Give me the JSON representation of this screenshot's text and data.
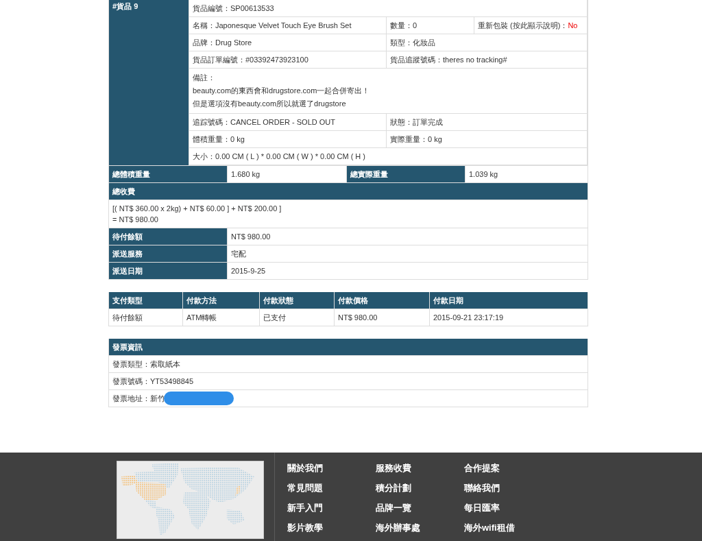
{
  "product": {
    "label": "#貨品 9",
    "rows": [
      [
        {
          "text": "貨品編號：SP00613533"
        }
      ],
      [
        {
          "text": "名稱：Japonesque Velvet Touch Eye Brush Set"
        },
        {
          "text": "數量：0"
        },
        {
          "text": "重新包裝 (按此顯示說明)：",
          "value": "No",
          "kind": "alert"
        }
      ],
      [
        {
          "text": "品牌：Drug Store"
        },
        {
          "text": "類型：化妝品"
        }
      ],
      [
        {
          "text": "貨品訂單編號：#03392473923100"
        },
        {
          "text": "貨品追蹤號碼：theres no tracking#"
        }
      ],
      [
        {
          "text": "備註：",
          "lines": [
            "beauty.com的東西會和drugstore.com一起合併寄出！",
            "但是選項沒有beauty.com所以就選了drugstore"
          ],
          "kind": "note"
        }
      ],
      [
        {
          "text": "追踪號碼：CANCEL ORDER - SOLD OUT"
        },
        {
          "text": "狀態：訂單完成"
        }
      ],
      [
        {
          "text": "體積重量：0 kg"
        },
        {
          "text": "實際重量：0 kg"
        }
      ],
      [
        {
          "text": "大小：0.00 CM ( L ) * 0.00 CM ( W ) * 0.00 CM ( H )"
        }
      ]
    ]
  },
  "weights": [
    {
      "label": "總體積重量",
      "value": "1.680 kg"
    },
    {
      "label": "總實際重量",
      "value": "1.039 kg"
    }
  ],
  "total_fee": {
    "label": "總收費",
    "lines": [
      "[( NT$ 360.00 x 2kg) + NT$ 60.00 ] + NT$ 200.00 ]",
      "= NT$ 980.00"
    ]
  },
  "summary": [
    {
      "label": "待付餘額",
      "value": "NT$ 980.00"
    },
    {
      "label": "派送服務",
      "value": "宅配"
    },
    {
      "label": "派送日期",
      "value": "2015-9-25"
    }
  ],
  "payments": {
    "columns": [
      "支付類型",
      "付款方法",
      "付款狀態",
      "付款價格",
      "付款日期"
    ],
    "rows": [
      [
        "待付餘額",
        "ATM轉帳",
        "已支付",
        "NT$ 980.00",
        "2015-09-21 23:17:19"
      ]
    ]
  },
  "invoice": {
    "title": "發票資訊",
    "rows": [
      {
        "text": "發票類型：索取紙本"
      },
      {
        "text": "發票號碼：YT53498845"
      },
      {
        "text": "發票地址：新竹",
        "redacted": true
      }
    ]
  },
  "footer": {
    "link_columns": [
      [
        "關於我們",
        "常見問題",
        "新手入門",
        "影片教學"
      ],
      [
        "服務收費",
        "積分計劃",
        "品牌一覽",
        "海外辦事處"
      ],
      [
        "合作提案",
        "聯絡我們",
        "每日匯率",
        "海外wifi租借"
      ]
    ]
  }
}
